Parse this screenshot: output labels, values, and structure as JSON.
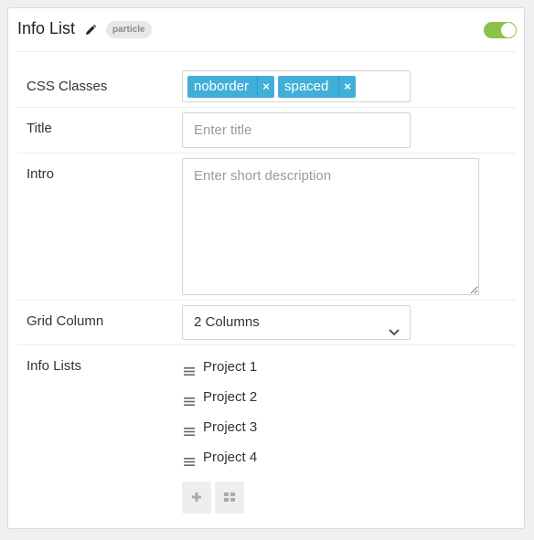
{
  "header": {
    "title": "Info List",
    "badge": "particle",
    "toggle_on": true,
    "toggle_color": "#8bc34a"
  },
  "fields": {
    "css_classes": {
      "label": "CSS Classes",
      "tags": [
        "noborder",
        "spaced"
      ],
      "remove_glyph": "×",
      "tag_color": "#42afd9"
    },
    "title": {
      "label": "Title",
      "value": "",
      "placeholder": "Enter title"
    },
    "intro": {
      "label": "Intro",
      "value": "",
      "placeholder": "Enter short description"
    },
    "grid_column": {
      "label": "Grid Column",
      "selected": "2 Columns"
    },
    "info_lists": {
      "label": "Info Lists",
      "items": [
        "Project 1",
        "Project 2",
        "Project 3",
        "Project 4"
      ]
    }
  },
  "actions": {
    "add_icon": "plus-icon",
    "grid_icon": "grid-icon"
  }
}
